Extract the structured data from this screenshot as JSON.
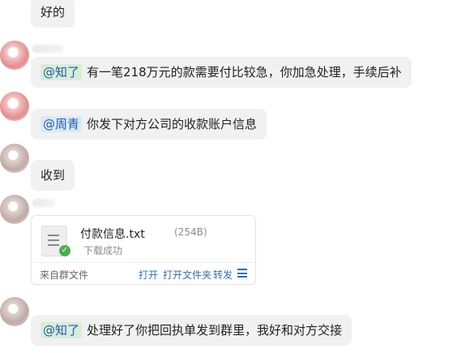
{
  "messages": [
    {
      "text": "好的"
    },
    {
      "mention": "@知了",
      "text": "有一笔218万元的款需要付比较急，你加急处理，手续后补"
    },
    {
      "mention": "@周青",
      "text": "你发下对方公司的收款账户信息"
    },
    {
      "text": "收到"
    },
    {
      "mention": "@知了",
      "text": "处理好了你把回执单发到群里，我好和对方交接"
    }
  ],
  "file": {
    "name": "付款信息.txt",
    "size": "(254B)",
    "status": "下载成功",
    "source": "来自群文件",
    "actions": {
      "open": "打开",
      "open_folder": "打开文件夹",
      "forward": "转发"
    },
    "icon": "document-icon",
    "menu_icon": "menu-icon"
  },
  "colors": {
    "bubble": "#f1f1f1",
    "mention_bg": "#d9ecd9",
    "mention_text": "#1f5fa8",
    "link": "#2e6fb8",
    "success": "#4caf50"
  }
}
